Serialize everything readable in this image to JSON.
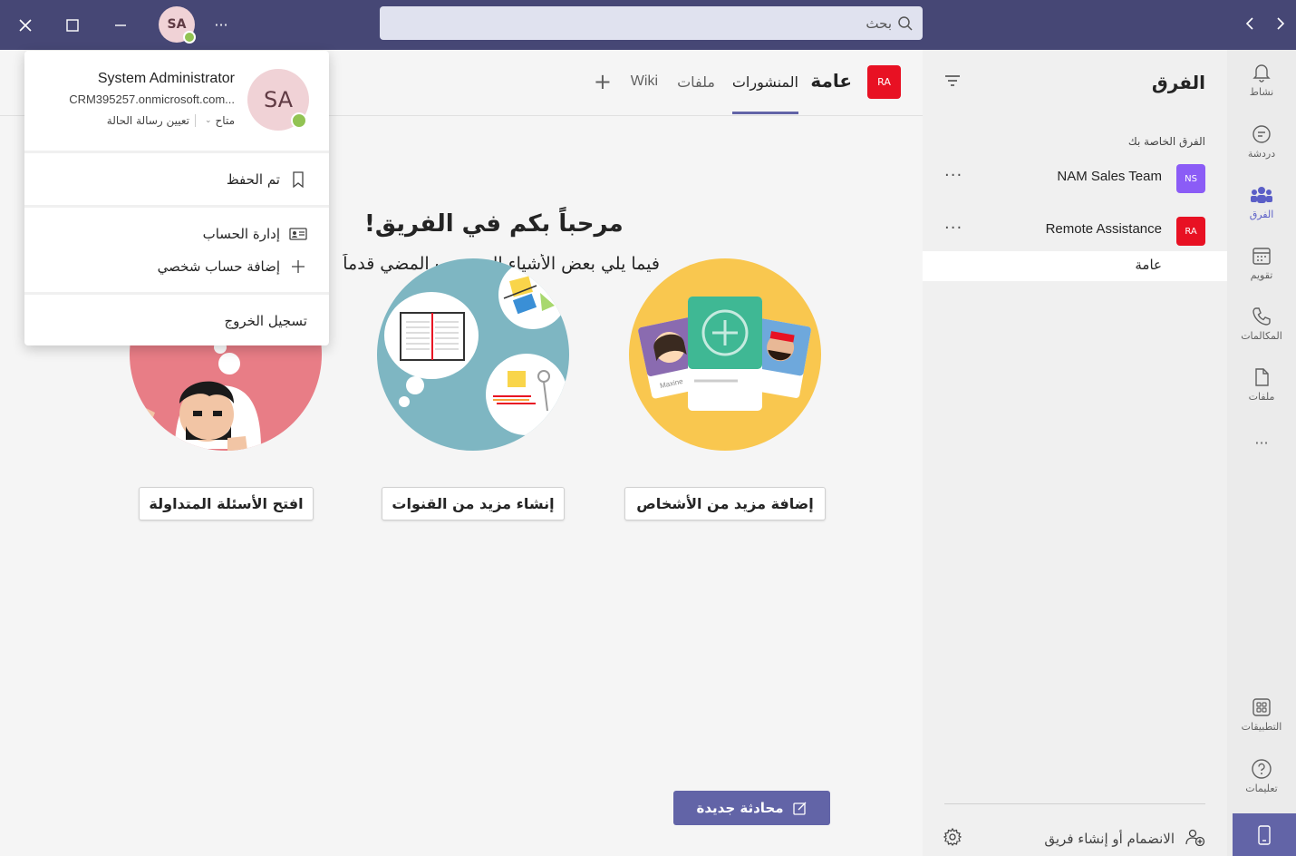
{
  "titlebar": {
    "avatar_initials": "SA",
    "search_placeholder": "بحث",
    "more": "···"
  },
  "rail": {
    "items": [
      {
        "label": "نشاط",
        "icon": "bell-icon"
      },
      {
        "label": "دردشة",
        "icon": "chat-icon"
      },
      {
        "label": "الفرق",
        "icon": "teams-icon"
      },
      {
        "label": "تقويم",
        "icon": "calendar-icon"
      },
      {
        "label": "المكالمات",
        "icon": "phone-icon"
      },
      {
        "label": "ملفات",
        "icon": "file-icon"
      }
    ],
    "more": "···",
    "apps_label": "التطبيقات",
    "help_label": "تعليمات"
  },
  "teams_panel": {
    "title": "الفرق",
    "section_label": "الفرق الخاصة بك",
    "teams": [
      {
        "badge": "NS",
        "name": "NAM Sales Team",
        "color": "#8b5cf6"
      },
      {
        "badge": "RA",
        "name": "Remote Assistance",
        "color": "#e81123"
      }
    ],
    "channel": "عامة",
    "join_label": "الانضمام أو إنشاء فريق",
    "more": "···"
  },
  "channel_header": {
    "badge": "RA",
    "title": "عامة",
    "tabs": [
      "المنشورات",
      "ملفات",
      "Wiki"
    ],
    "add": "+"
  },
  "welcome": {
    "title": "مرحباً بكم في الفريق!",
    "subtitle": "فيما يلي بعض الأشياء التي يجب المضي قدماً"
  },
  "actions": {
    "add_people": "إضافة مزيد من الأشخاص",
    "create_channels": "إنشاء مزيد من القنوات",
    "open_faq": "افتح الأسئلة المتداولة"
  },
  "illustration": {
    "card_name_1": "Maxine"
  },
  "new_conversation": "محادثة جديدة",
  "profile_popup": {
    "initials": "SA",
    "name": "System Administrator",
    "email": "CRM395257.onmicrosoft.com...",
    "status": "متاح",
    "set_status": "تعيين رسالة الحالة",
    "saved": "تم الحفظ",
    "manage_account": "إدارة الحساب",
    "add_personal": "إضافة حساب شخصي",
    "sign_out": "تسجيل الخروج"
  },
  "colors": {
    "titlebar": "#464775",
    "accent": "#6264a7",
    "presence": "#92c353"
  }
}
